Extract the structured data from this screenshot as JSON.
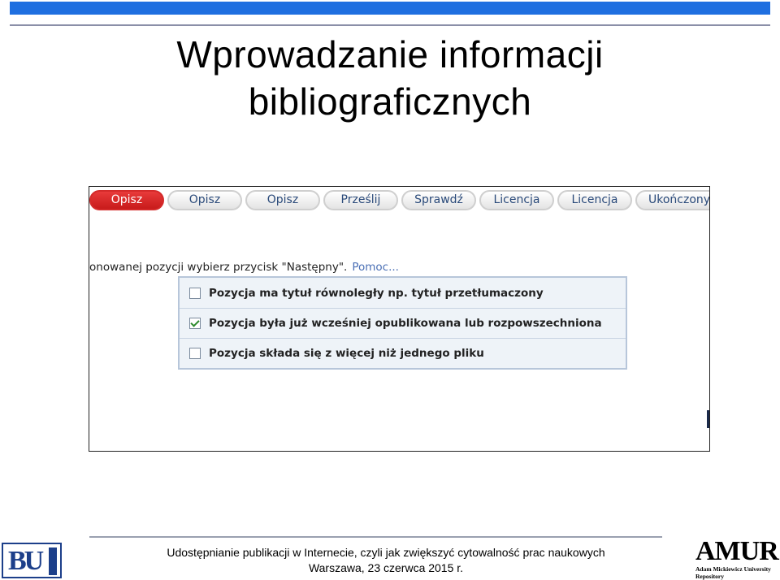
{
  "slide": {
    "title_line1": "Wprowadzanie informacji",
    "title_line2": "bibliograficznych"
  },
  "screenshot": {
    "tabs": [
      {
        "label": "Opisz",
        "active": true
      },
      {
        "label": "Opisz",
        "active": false
      },
      {
        "label": "Opisz",
        "active": false
      },
      {
        "label": "Prześlij",
        "active": false
      },
      {
        "label": "Sprawdź",
        "active": false
      },
      {
        "label": "Licencja",
        "active": false
      },
      {
        "label": "Licencja",
        "active": false
      },
      {
        "label": "Ukończony",
        "active": false
      }
    ],
    "instruction": "onowanej pozycji wybierz przycisk \"Następny\".",
    "help_link": "Pomoc...",
    "options": [
      {
        "label": "Pozycja ma tytuł równoległy np. tytuł przetłumaczony",
        "checked": false
      },
      {
        "label": "Pozycja była już wcześniej opublikowana lub rozpowszechniona",
        "checked": true
      },
      {
        "label": "Pozycja składa się z więcej niż jednego pliku",
        "checked": false
      }
    ]
  },
  "footer": {
    "line1": "Udostępnianie publikacji w Internecie, czyli jak zwiększyć cytowalność prac naukowych",
    "line2": "Warszawa, 23 czerwca 2015 r."
  },
  "logos": {
    "left_text": "BU",
    "right_word": "AMUR",
    "right_sub1": "Adam Mickiewicz University",
    "right_sub2": "Repository"
  },
  "colors": {
    "accent_blue": "#1f6fe0",
    "active_tab_red": "#d42a2a",
    "link_blue": "#4a6fb5"
  }
}
